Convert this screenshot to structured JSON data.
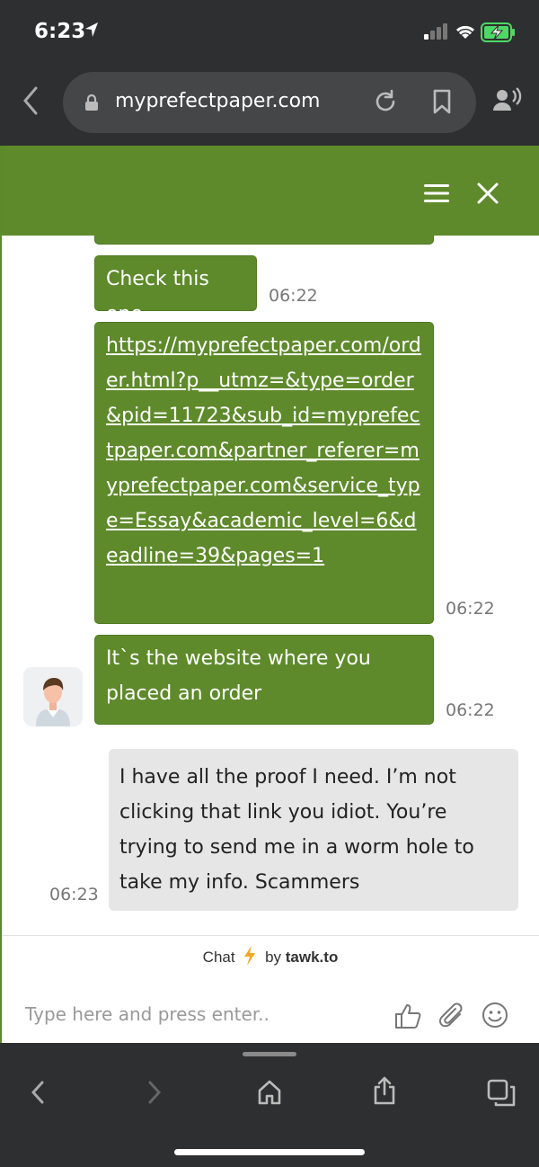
{
  "status_bar": {
    "time": "6:23"
  },
  "browser": {
    "url": "myprefectpaper.com"
  },
  "chat": {
    "messages": [
      {
        "text": "Check this one",
        "time": "06:22"
      },
      {
        "text": "https://myprefectpaper.com/order.html?p__utmz=&type=order&pid=11723&sub_id=myprefectpaper.com&partner_referer=myprefectpaper.com&service_type=Essay&academic_level=6&deadline=39&pages=1",
        "time": "06:22"
      },
      {
        "text": "It`s the website where you placed an order",
        "time": "06:22"
      },
      {
        "text": "I have all the proof I need. I’m not clicking that link you idiot. You’re trying to send me in a worm hole to take my info. Scammers",
        "time": "06:23"
      }
    ],
    "powered_prefix": "Chat",
    "powered_by": "by",
    "powered_brand": "tawk.to",
    "input_placeholder": "Type here and press enter.."
  },
  "colors": {
    "brand_green": "#5e8a2b",
    "user_bubble": "#e6e6e6",
    "chrome_dark": "#2e2f30"
  }
}
